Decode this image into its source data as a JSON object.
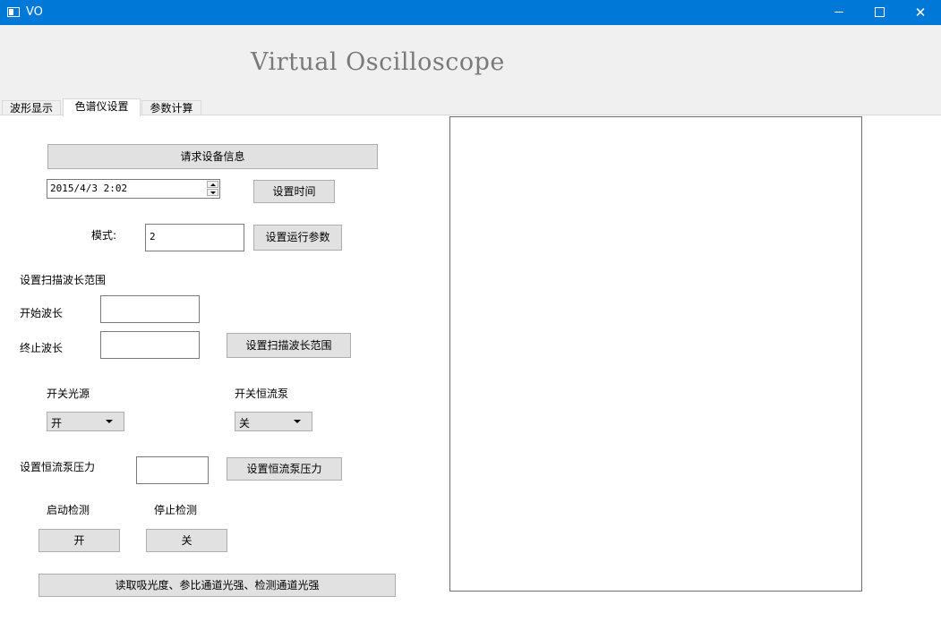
{
  "window": {
    "title": "VO"
  },
  "heading": "Virtual Oscilloscope",
  "tabs": [
    {
      "label": "波形显示"
    },
    {
      "label": "色谱仪设置"
    },
    {
      "label": "参数计算"
    }
  ],
  "panel": {
    "request_device_info_button": "请求设备信息",
    "datetime_value": "2015/4/3 2:02",
    "set_time_button": "设置时间",
    "mode_label": "模式:",
    "mode_value": "2",
    "set_run_params_button": "设置运行参数",
    "scan_range_heading": "设置扫描波长范围",
    "start_wavelength_label": "开始波长",
    "start_wavelength_value": "",
    "end_wavelength_label": "终止波长",
    "end_wavelength_value": "",
    "set_scan_range_button": "设置扫描波长范围",
    "light_source_label": "开关光源",
    "light_source_value": "开",
    "pump_label": "开关恒流泵",
    "pump_value": "关",
    "pump_pressure_label": "设置恒流泵压力",
    "pump_pressure_value": "",
    "set_pump_pressure_button": "设置恒流泵压力",
    "start_detect_label": "启动检测",
    "stop_detect_label": "停止检测",
    "start_button": "开",
    "stop_button": "关",
    "read_button": "读取吸光度、参比通道光强、检测通道光强"
  }
}
